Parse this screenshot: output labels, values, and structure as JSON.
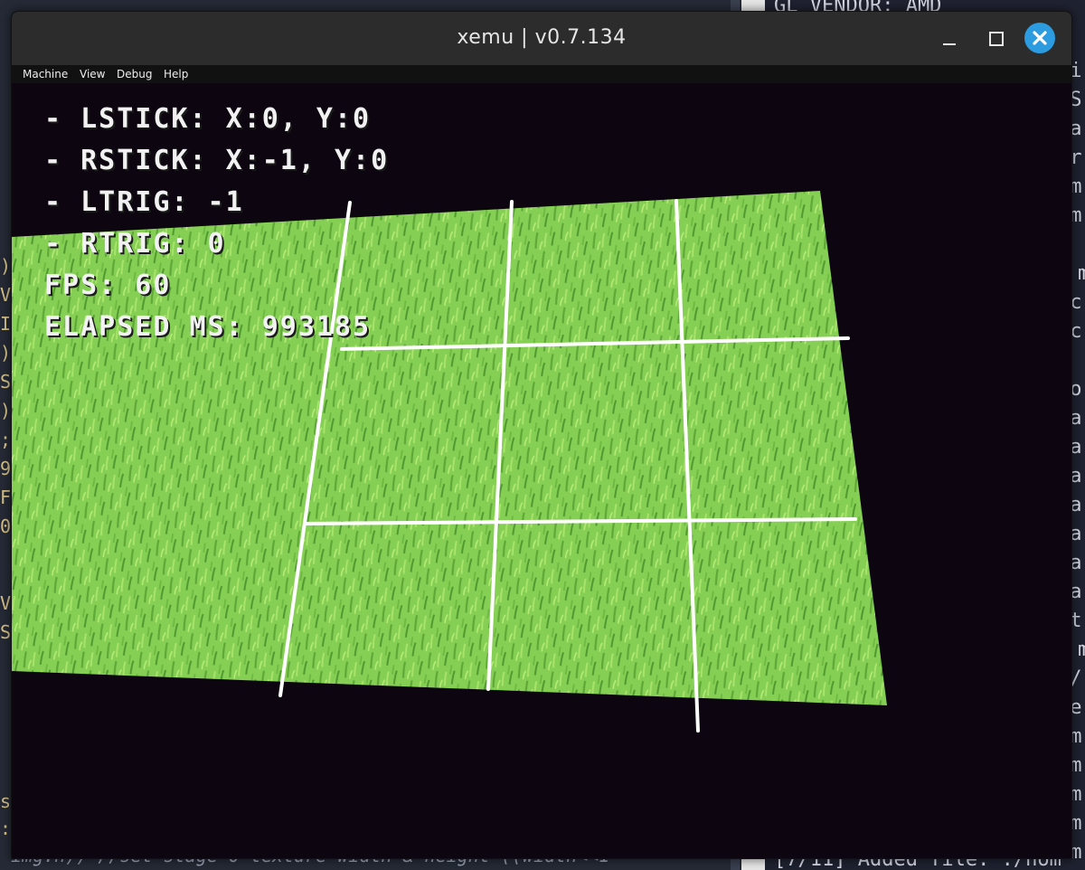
{
  "window": {
    "title": "xemu | v0.7.134",
    "menu": [
      "Machine",
      "View",
      "Debug",
      "Help"
    ]
  },
  "hud": {
    "lines": [
      "- LSTICK: X:0, Y:0",
      "- RSTICK: X:-1, Y:0",
      "- LTRIG: -1",
      "- RTRIG: 0",
      "FPS: 60",
      "ELAPSED MS: 993185"
    ]
  },
  "colors": {
    "titlebar": "#2c2c2c",
    "viewport": "#0d0610",
    "grass_light": "#8ed45a",
    "grass_dark": "#5fa838",
    "grid_lines": "#ffffff",
    "close_button": "#2d9be0"
  },
  "background_editor": {
    "bottom_line": "img.h)) //set stage 0 texture width & height ((width<<1"
  },
  "background_log": {
    "top_line": "GL_VENDOR: AMD",
    "bottom_line": "[7/11] Added file: ./hom"
  }
}
